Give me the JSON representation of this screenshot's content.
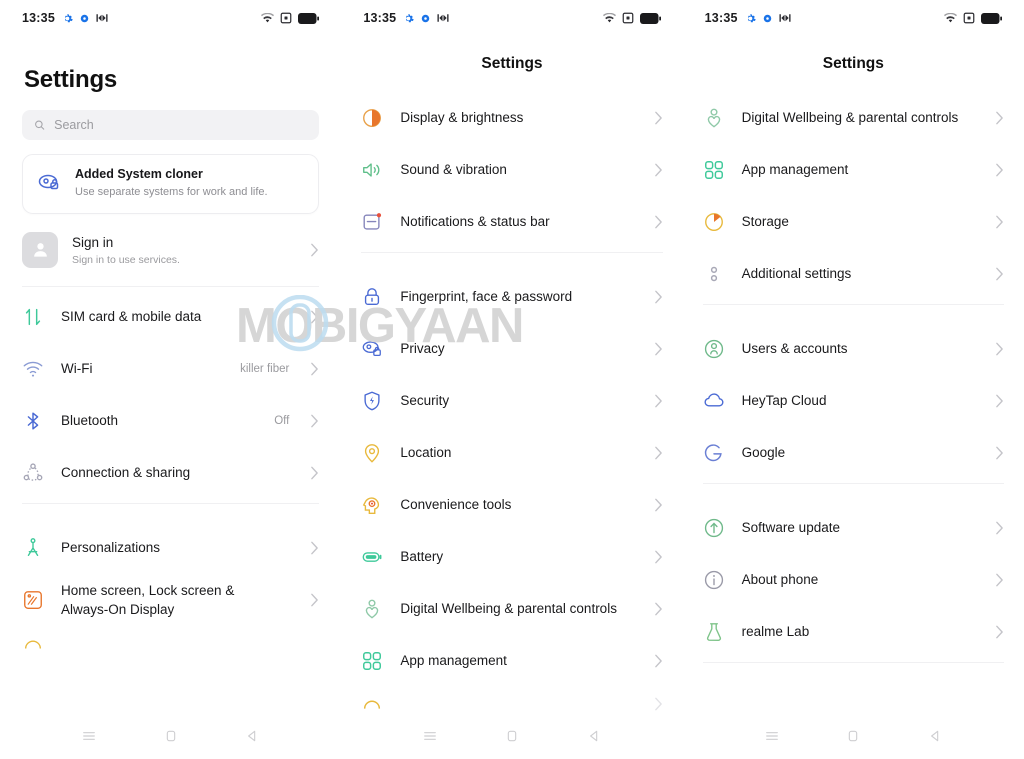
{
  "statusbar": {
    "time": "13:35",
    "left_icons": [
      "gear-icon",
      "dot-icon",
      "network-icon"
    ],
    "right_icons": [
      "wifi-icon",
      "screen-record-icon",
      "battery-icon"
    ]
  },
  "watermark": {
    "text": "MOBIGYAAN"
  },
  "navbar": {
    "menu_label": "menu-button",
    "home_label": "home-button",
    "back_label": "back-button"
  },
  "colors": {
    "accent_green": "#3ec99a",
    "accent_blue": "#4a6ad4",
    "accent_orange": "#e8762c",
    "accent_yellow": "#e8b93c",
    "text_primary": "#1a1a1c",
    "text_secondary": "#9a9a9e",
    "divider": "#f0f0f2",
    "search_bg": "#f2f2f4"
  },
  "screen1": {
    "title": "Settings",
    "search": {
      "placeholder": "Search",
      "value": ""
    },
    "promo": {
      "title": "Added System cloner",
      "subtitle": "Use separate systems for work and life.",
      "icon": "system-cloner-icon"
    },
    "account": {
      "title": "Sign in",
      "subtitle": "Sign in to use services.",
      "icon": "avatar-person-icon"
    },
    "items": [
      {
        "label": "SIM card & mobile data",
        "value": "",
        "icon": "sim-data-arrows-icon",
        "color": "#3ec99a"
      },
      {
        "label": "Wi-Fi",
        "value": "killer fiber",
        "icon": "wifi-icon",
        "color": "#7a8ecf"
      },
      {
        "label": "Bluetooth",
        "value": "Off",
        "icon": "bluetooth-icon",
        "color": "#4a6ad4"
      },
      {
        "label": "Connection & sharing",
        "value": "",
        "icon": "connection-sharing-icon",
        "color": "#a0a0b4"
      },
      {
        "label": "Personalizations",
        "value": "",
        "icon": "personalizations-compass-icon",
        "color": "#3ec99a"
      },
      {
        "label": "Home screen, Lock screen & Always-On Display",
        "value": "",
        "icon": "home-lock-screen-icon",
        "color": "#e8762c"
      }
    ],
    "divider_after": [
      3
    ]
  },
  "screen2": {
    "title": "Settings",
    "items": [
      {
        "label": "Display & brightness",
        "value": "",
        "icon": "display-brightness-icon",
        "color": "#e8762c"
      },
      {
        "label": "Sound & vibration",
        "value": "",
        "icon": "sound-vibration-icon",
        "color": "#5fbf8a"
      },
      {
        "label": "Notifications & status bar",
        "value": "",
        "icon": "notifications-status-bar-icon",
        "color": "#7a7ab4"
      },
      {
        "label": "Fingerprint, face & password",
        "value": "",
        "icon": "fingerprint-lock-icon",
        "color": "#4a6ad4"
      },
      {
        "label": "Privacy",
        "value": "",
        "icon": "privacy-eye-icon",
        "color": "#4a6ad4"
      },
      {
        "label": "Security",
        "value": "",
        "icon": "security-shield-icon",
        "color": "#4a6ad4"
      },
      {
        "label": "Location",
        "value": "",
        "icon": "location-pin-icon",
        "color": "#e8b93c"
      },
      {
        "label": "Convenience tools",
        "value": "",
        "icon": "convenience-tools-head-icon",
        "color": "#e8b93c"
      },
      {
        "label": "Battery",
        "value": "",
        "icon": "battery-icon",
        "color": "#3ec99a"
      },
      {
        "label": "Digital Wellbeing & parental controls",
        "value": "",
        "icon": "digital-wellbeing-icon",
        "color": "#7fc4a0"
      },
      {
        "label": "App management",
        "value": "",
        "icon": "app-management-icon",
        "color": "#3ec99a"
      }
    ],
    "divider_after": [
      2
    ]
  },
  "screen3": {
    "title": "Settings",
    "items": [
      {
        "label": "Digital Wellbeing & parental controls",
        "value": "",
        "icon": "digital-wellbeing-icon",
        "color": "#7fc4a0"
      },
      {
        "label": "App management",
        "value": "",
        "icon": "app-management-icon",
        "color": "#3ec99a"
      },
      {
        "label": "Storage",
        "value": "",
        "icon": "storage-pie-icon",
        "color": "#e8b93c"
      },
      {
        "label": "Additional settings",
        "value": "",
        "icon": "additional-settings-icon",
        "color": "#a0a0b4"
      },
      {
        "label": "Users & accounts",
        "value": "",
        "icon": "users-accounts-icon",
        "color": "#6fb98a"
      },
      {
        "label": "HeyTap Cloud",
        "value": "",
        "icon": "heytap-cloud-icon",
        "color": "#4a6ad4"
      },
      {
        "label": "Google",
        "value": "",
        "icon": "google-g-icon",
        "color": "#6a7fd4"
      },
      {
        "label": "Software update",
        "value": "",
        "icon": "software-update-icon",
        "color": "#6fb98a"
      },
      {
        "label": "About phone",
        "value": "",
        "icon": "about-phone-info-icon",
        "color": "#9a9aa8"
      },
      {
        "label": "realme Lab",
        "value": "",
        "icon": "realme-lab-flask-icon",
        "color": "#7fc48a"
      }
    ],
    "divider_after": [
      3,
      6,
      9
    ]
  }
}
